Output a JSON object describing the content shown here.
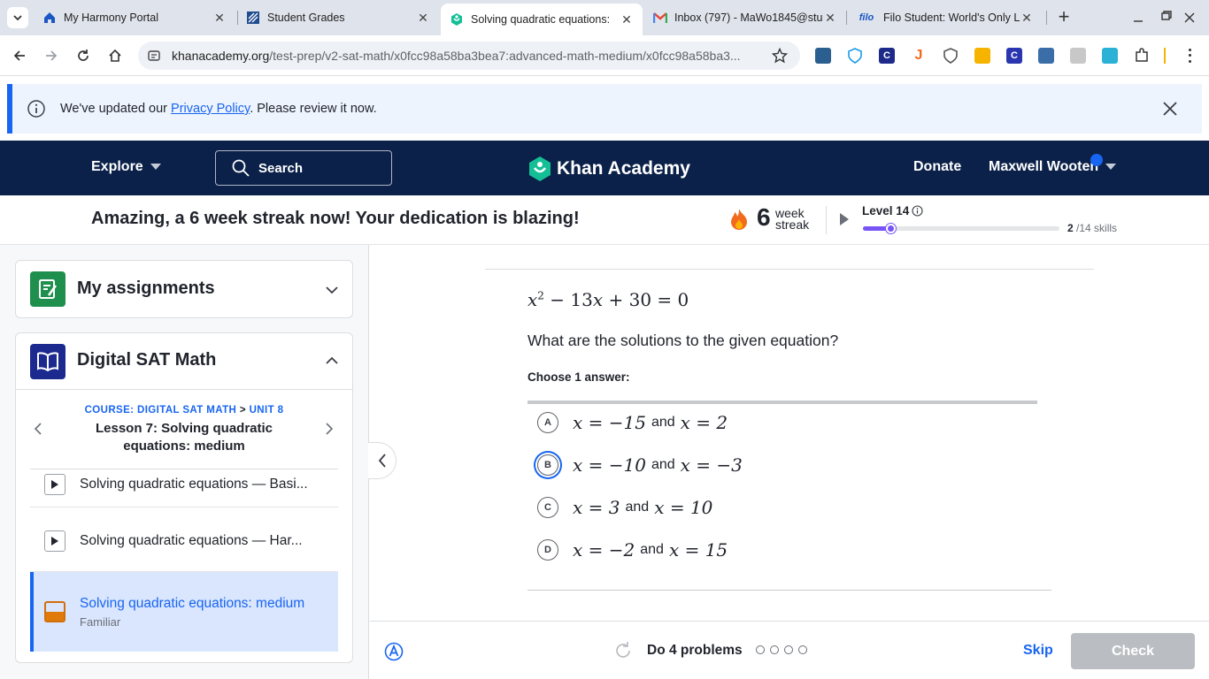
{
  "browser": {
    "tabs": [
      {
        "title": "My Harmony Portal",
        "icon": "harmony-icon"
      },
      {
        "title": "Student Grades",
        "icon": "grades-icon"
      },
      {
        "title": "Solving quadratic equations:",
        "icon": "khan-academy-icon",
        "active": true
      },
      {
        "title": "Inbox (797) - MaWo1845@stu",
        "icon": "gmail-icon"
      },
      {
        "title": "Filo Student: World's Only Liv",
        "icon": "filo-icon"
      }
    ],
    "url_host": "khanacademy.org",
    "url_path": "/test-prep/v2-sat-math/x0fcc98a58ba3bea7:advanced-math-medium/x0fcc98a58ba3..."
  },
  "banner": {
    "text_before": "We've updated our ",
    "link": "Privacy Policy",
    "text_after": ". Please review it now."
  },
  "header": {
    "explore": "Explore",
    "search_placeholder": "Search",
    "logo_text": "Khan Academy",
    "donate": "Donate",
    "user_name": "Maxwell Wooten"
  },
  "streak": {
    "message": "Amazing, a 6 week streak now! Your dedication is blazing!",
    "count": "6",
    "unit_line1": "week",
    "unit_line2": "streak",
    "level_label": "Level 14",
    "skills_done": "2",
    "skills_total": "/14 skills",
    "progress_fraction": 0.14
  },
  "sidebar": {
    "assignments_title": "My assignments",
    "course_title": "Digital SAT Math",
    "breadcrumb_course": "COURSE: DIGITAL SAT MATH",
    "breadcrumb_sep": ">",
    "breadcrumb_unit": "UNIT 8",
    "lesson_title": "Lesson 7: Solving quadratic equations: medium",
    "items": [
      {
        "label": "Solving quadratic equations — Basi...",
        "type": "video"
      },
      {
        "label": "Solving quadratic equations — Har...",
        "type": "video"
      },
      {
        "label": "Solving quadratic equations: medium",
        "sublabel": "Familiar",
        "type": "exercise",
        "active": true
      }
    ]
  },
  "question": {
    "equation": "x² − 13x + 30 = 0",
    "prompt": "What are the solutions to the given equation?",
    "instruction": "Choose 1 answer:",
    "choices": [
      {
        "letter": "A",
        "left": "x = −15",
        "and": "and",
        "right": "x = 2"
      },
      {
        "letter": "B",
        "left": "x = −10",
        "and": "and",
        "right": "x = −3",
        "selected": true
      },
      {
        "letter": "C",
        "left": "x = 3",
        "and": "and",
        "right": "x = 10"
      },
      {
        "letter": "D",
        "left": "x = −2",
        "and": "and",
        "right": "x = 15"
      }
    ]
  },
  "footer": {
    "task": "Do 4 problems",
    "problem_count": 4,
    "skip": "Skip",
    "check": "Check"
  },
  "colors": {
    "ka_navy": "#0b2149",
    "ka_blue": "#1865f2",
    "streak_purple": "#7854f7"
  }
}
